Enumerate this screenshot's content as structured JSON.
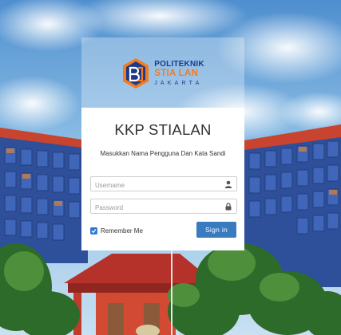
{
  "logo": {
    "line1": "POLITEKNIK",
    "line2": "STIA LAN",
    "line3": "JAKARTA",
    "color_primary": "#1b3a8c",
    "color_accent": "#f47b20"
  },
  "login": {
    "title": "KKP STIALAN",
    "subtitle": "Masukkan Nama Pengguna Dan Kata Sandi",
    "username_placeholder": "Username",
    "username_icon": "user-icon",
    "password_placeholder": "Password",
    "password_icon": "lock-icon",
    "remember_label": "Remember Me",
    "remember_checked": true,
    "signin_label": "Sign in",
    "accent_color": "#3a7bc0"
  }
}
